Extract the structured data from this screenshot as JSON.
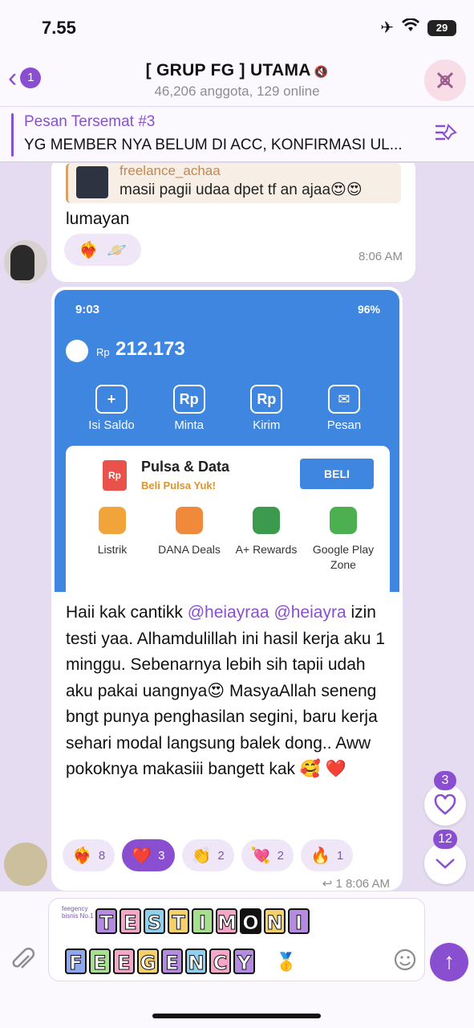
{
  "status_bar": {
    "time": "7.55",
    "battery": "29"
  },
  "header": {
    "back_badge": "1",
    "title": "[ GRUP FG ] UTAMA",
    "subtitle": "46,206 anggota, 129 online"
  },
  "pinned": {
    "title": "Pesan Tersemat #3",
    "text": "YG MEMBER NYA BELUM DI ACC, KONFIRMASI UL..."
  },
  "messages": [
    {
      "reply_name": "freelance_achaa",
      "reply_text": "masii pagii udaa dpet tf an ajaa😍😍",
      "text": "lumayan",
      "reactions": [
        "❤️‍🔥",
        "🪐"
      ],
      "time": "8:06 AM"
    },
    {
      "screenshot": {
        "time": "9:03",
        "status": "96%",
        "currency": "Rp",
        "balance": "212.173",
        "menu": [
          {
            "icon": "+",
            "label": "Isi Saldo"
          },
          {
            "icon": "Rp",
            "label": "Minta"
          },
          {
            "icon": "Rp",
            "label": "Kirim"
          },
          {
            "icon": "✉",
            "label": "Pesan"
          }
        ],
        "promo_icon": "Rp",
        "promo_title": "Pulsa & Data",
        "promo_sub": "Beli Pulsa Yuk!",
        "promo_button": "BELI",
        "services": [
          {
            "label": "Listrik",
            "color": "#f0a43a"
          },
          {
            "label": "DANA Deals",
            "color": "#f08a3a"
          },
          {
            "label": "A+ Rewards",
            "color": "#3c9a4e"
          },
          {
            "label": "Google Play Zone",
            "color": "#4caf50"
          }
        ]
      },
      "text_before": "Haii kak cantikk ",
      "mention1": "@heiayraa",
      "mention2": "@heiayra",
      "text_after": " izin testi yaa. Alhamdulillah ini hasil kerja aku 1 minggu. Sebenarnya lebih sih tapii udah aku pakai uangnya😍 MasyaAllah seneng bngt punya penghasilan segini, baru kerja sehari modal langsung balek dong.. Aww pokoknya makasiii bangett kak 🥰 ❤️",
      "reactions": [
        {
          "emoji": "❤️‍🔥",
          "count": "8"
        },
        {
          "emoji": "❤️",
          "count": "3"
        },
        {
          "emoji": "👏",
          "count": "2"
        },
        {
          "emoji": "💘",
          "count": "2"
        },
        {
          "emoji": "🔥",
          "count": "1"
        }
      ],
      "replies": "↩ 1",
      "time": "8:06 AM"
    }
  ],
  "floating": {
    "reactions_count": "3",
    "mentions_count": "12"
  },
  "composer": {
    "sticker_tag": "feegency bisnis No.1",
    "line1": [
      "T",
      "E",
      "S",
      "T",
      "I",
      "M",
      "O",
      "N",
      "I"
    ],
    "line2": [
      "F",
      "E",
      "E",
      "G",
      "E",
      "N",
      "C",
      "Y"
    ],
    "line1_colors": [
      "#b48be0",
      "#f6a6c8",
      "#8fd0f0",
      "#f6d06a",
      "#a6e08f",
      "#f6a6c8",
      "#111111",
      "#f6d06a",
      "#b48be0"
    ],
    "line2_colors": [
      "#8fa6f0",
      "#a6e08f",
      "#f6a6c8",
      "#f6d06a",
      "#b48be0",
      "#8fd0f0",
      "#f6a6c8",
      "#b48be0"
    ]
  }
}
